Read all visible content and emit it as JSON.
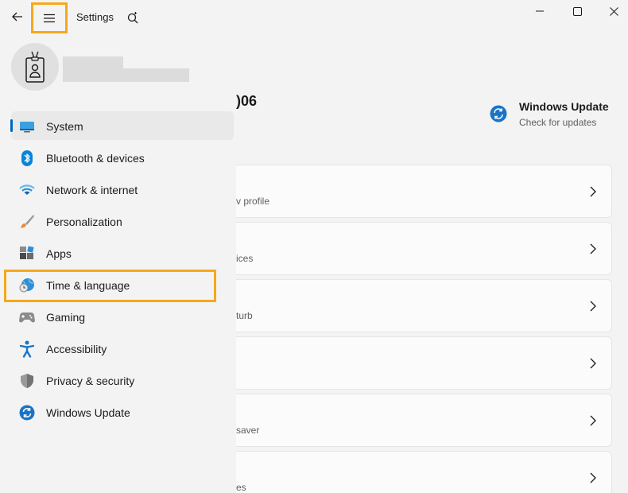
{
  "window": {
    "title": "Settings"
  },
  "profile": {
    "avatar_icon": "id-badge-icon"
  },
  "nav": {
    "items": [
      {
        "label": "System",
        "icon": "monitor-icon"
      },
      {
        "label": "Bluetooth & devices",
        "icon": "bluetooth-icon"
      },
      {
        "label": "Network & internet",
        "icon": "wifi-icon"
      },
      {
        "label": "Personalization",
        "icon": "brush-icon"
      },
      {
        "label": "Apps",
        "icon": "apps-icon"
      },
      {
        "label": "Time & language",
        "icon": "globe-clock-icon"
      },
      {
        "label": "Gaming",
        "icon": "gamepad-icon"
      },
      {
        "label": "Accessibility",
        "icon": "accessibility-icon"
      },
      {
        "label": "Privacy & security",
        "icon": "shield-icon"
      },
      {
        "label": "Windows Update",
        "icon": "update-icon"
      }
    ],
    "selected_index": 0
  },
  "main": {
    "device_name_fragment": ")06",
    "windows_update": {
      "title": "Windows Update",
      "subtitle": "Check for updates"
    },
    "cards": [
      {
        "text": "v profile"
      },
      {
        "text": "ices"
      },
      {
        "text": "turb"
      },
      {
        "text": ""
      },
      {
        "text": "saver"
      },
      {
        "text": "es"
      }
    ]
  },
  "colors": {
    "accent": "#0067c0",
    "highlight": "#f5a81c",
    "background": "#f3f3f3"
  }
}
